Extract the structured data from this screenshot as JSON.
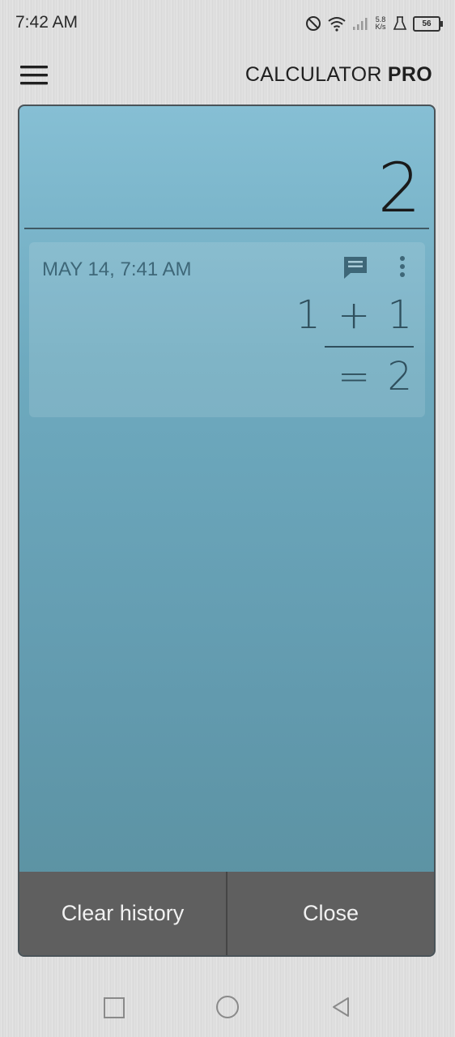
{
  "status_bar": {
    "time": "7:42 AM",
    "net_speed_value": "5.8",
    "net_speed_unit": "K/s",
    "battery": "56",
    "icons": [
      "dnd-icon",
      "wifi-icon",
      "signal-icon",
      "flask-icon",
      "battery-icon"
    ]
  },
  "header": {
    "title_main": "CALCULATOR ",
    "title_bold": "PRO"
  },
  "display": {
    "value": "2"
  },
  "history": [
    {
      "date": "MAY 14, 7:41 AM",
      "expression": "1 + 1",
      "result": "= 2"
    }
  ],
  "buttons": {
    "clear_history": "Clear history",
    "close": "Close"
  },
  "colors": {
    "panel_top": "#86bfd4",
    "panel_bottom": "#5a909f",
    "button_bg": "#5f5f5f"
  }
}
